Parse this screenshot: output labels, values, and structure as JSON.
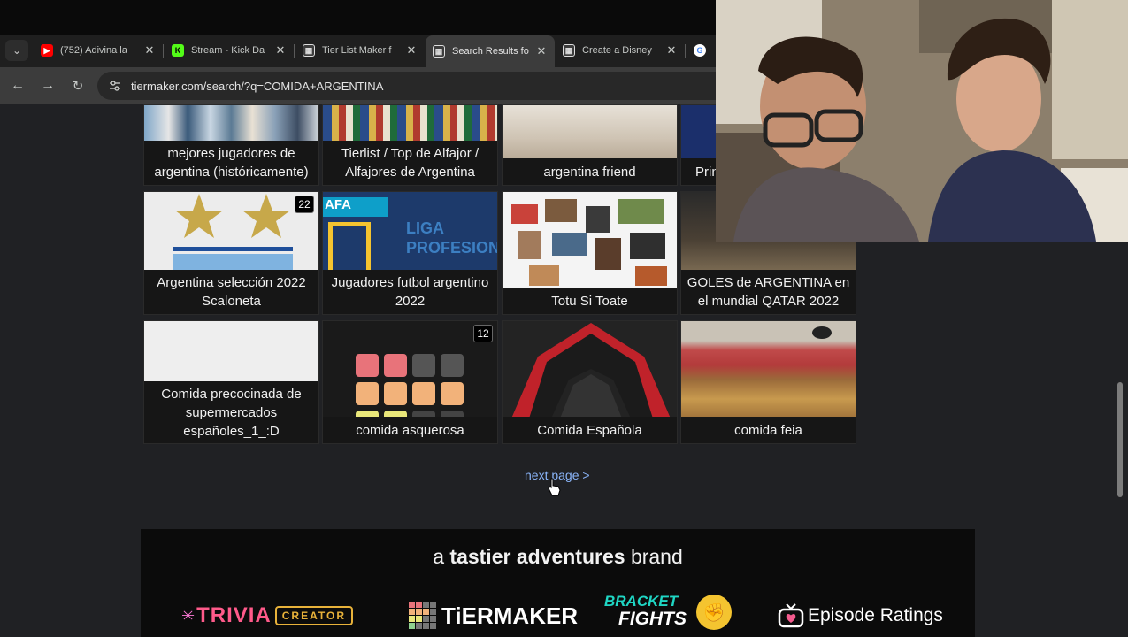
{
  "browser": {
    "tabs": [
      {
        "title": "(752) Adivina la",
        "favicon": "youtube-icon",
        "color": "#ff0000"
      },
      {
        "title": "Stream - Kick Da",
        "favicon": "kick-icon",
        "color": "#53fc18"
      },
      {
        "title": "Tier List Maker f",
        "favicon": "tiermaker-icon",
        "color": "#ffffff"
      },
      {
        "title": "Search Results fo",
        "favicon": "tiermaker-icon",
        "color": "#ffffff"
      },
      {
        "title": "Create a Disney",
        "favicon": "tiermaker-icon",
        "color": "#ffffff"
      },
      {
        "title": "",
        "favicon": "google-icon",
        "color": "#4285f4"
      }
    ],
    "url": "tiermaker.com/search/?q=COMIDA+ARGENTINA"
  },
  "results": {
    "row1": [
      {
        "caption": "mejores jugadores de argentina (históricamente)"
      },
      {
        "caption": "Tierlist / Top de Alfajor / Alfajores de Argentina"
      },
      {
        "caption": "argentina friend"
      },
      {
        "caption": "Prin"
      }
    ],
    "row2": [
      {
        "caption": "Argentina selección 2022 Scaloneta",
        "badge": "22"
      },
      {
        "caption": "Jugadores futbol argentino 2022",
        "thumb_text": "AFA",
        "thumb_text2": "LIGA PROFESIONAL"
      },
      {
        "caption": "Totu Si Toate"
      },
      {
        "caption": "GOLES de ARGENTINA en el mundial QATAR 2022"
      }
    ],
    "row3": [
      {
        "caption": "Comida precocinada de supermercados españoles_1_:D"
      },
      {
        "caption": "comida asquerosa",
        "badge": "12"
      },
      {
        "caption": "Comida Española"
      },
      {
        "caption": "comida feia"
      }
    ]
  },
  "pagination": {
    "next_label": "next page >"
  },
  "footer": {
    "brand_prefix": "a",
    "brand_bold": "tastier adventures",
    "brand_suffix": "brand",
    "logos": {
      "trivia": "TRIVIA",
      "creator": "CREATOR",
      "tiermaker": "TiERMAKER",
      "bracket": "BRACKET",
      "fights": "FIGHTS",
      "episode": "Episode Ratings"
    }
  },
  "colors": {
    "link": "#8ab4f8",
    "tiermaker_red": "#e8737a",
    "tiermaker_orange": "#f2b27a"
  }
}
